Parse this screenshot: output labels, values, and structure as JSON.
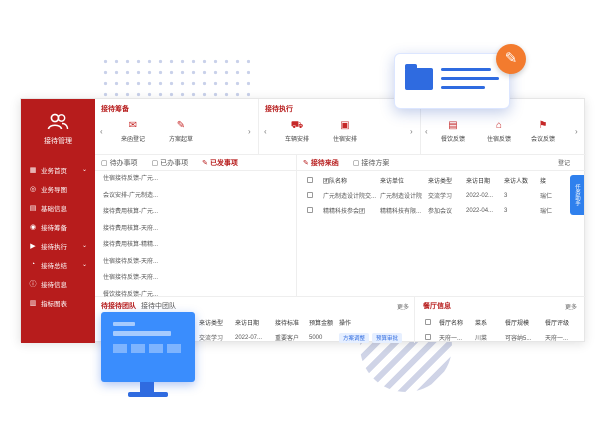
{
  "sidebar": {
    "title": "接待管理",
    "items": [
      {
        "icon": "grid-icon",
        "label": "业务首页",
        "expand": true
      },
      {
        "icon": "compass-icon",
        "label": "业务导图",
        "expand": false
      },
      {
        "icon": "file-icon",
        "label": "基础信息",
        "expand": false
      },
      {
        "icon": "bell-icon",
        "label": "接待筹备",
        "expand": false
      },
      {
        "icon": "play-icon",
        "label": "接待执行",
        "expand": true
      },
      {
        "icon": "chart-icon",
        "label": "接待总结",
        "expand": true
      },
      {
        "icon": "info-icon",
        "label": "接待信息",
        "expand": false
      },
      {
        "icon": "bar-chart-icon",
        "label": "指标图表",
        "expand": false
      }
    ]
  },
  "prep": {
    "title": "接待筹备",
    "entries": [
      {
        "icon": "mail-icon",
        "label": "来函登记"
      },
      {
        "icon": "edit-icon",
        "label": "方案起草"
      }
    ]
  },
  "exec": {
    "title": "接待执行",
    "entries": [
      {
        "icon": "car-icon",
        "label": "车辆安排"
      },
      {
        "icon": "building-icon",
        "label": "住宿安排"
      }
    ]
  },
  "feedback": {
    "entries": [
      {
        "icon": "meal-icon",
        "label": "餐饮反馈"
      },
      {
        "icon": "home-icon",
        "label": "住宿反馈"
      },
      {
        "icon": "meeting-icon",
        "label": "会议反馈"
      }
    ]
  },
  "tasks": {
    "tabs": [
      "待办事项",
      "已办事项",
      "已发事项"
    ],
    "active_tab": 2,
    "items": [
      "住宿接待反馈-广元...",
      "会议安排-广元制造...",
      "接待费用核算-广元...",
      "接待费用核算-天府...",
      "接待费用核算-精精...",
      "住宿接待反馈-天府...",
      "住宿接待反馈-天府...",
      "餐饮接待反馈-广元..."
    ]
  },
  "visits": {
    "tabs": [
      "接待来函",
      "接待方案"
    ],
    "active_tab": 0,
    "action": "登记",
    "columns": [
      "团队名称",
      "来访单位",
      "来访类型",
      "来访日期",
      "来访人数",
      "接"
    ],
    "rows": [
      [
        "广元制造设计院交...",
        "广元制造设计院",
        "交流学习",
        "2022-02...",
        "3",
        "瑞仁"
      ],
      [
        "精精科技参会团",
        "精精科技有限...",
        "参加会议",
        "2022-04...",
        "3",
        "瑞仁"
      ]
    ]
  },
  "pending": {
    "title": "待接待团队",
    "subtitle": "接待中团队",
    "more": "更多",
    "columns": [
      "来访类型",
      "来访日期",
      "接待标准",
      "预算金额",
      "操作"
    ],
    "row": [
      "交流学习",
      "2022-07...",
      "重要客户",
      "5000"
    ],
    "actions": [
      "方案调整",
      "预算审批"
    ]
  },
  "restaurants": {
    "title": "餐厅信息",
    "more": "更多",
    "columns": [
      "餐厅名称",
      "菜系",
      "餐厅规模",
      "餐厅评级"
    ],
    "row": [
      "天府一...",
      "川菜",
      "可容纳5...",
      "天府一..."
    ]
  },
  "float_button": "任务助手"
}
